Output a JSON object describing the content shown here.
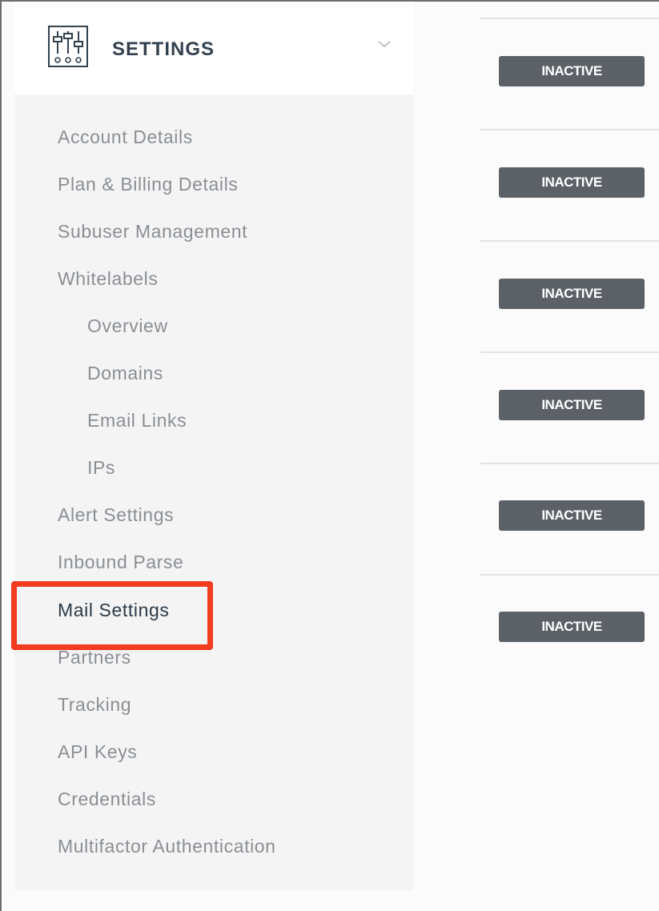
{
  "sidebar": {
    "title": "SETTINGS",
    "items": [
      {
        "label": "Account Details"
      },
      {
        "label": "Plan & Billing Details"
      },
      {
        "label": "Subuser Management"
      },
      {
        "label": "Whitelabels"
      },
      {
        "label": "Overview"
      },
      {
        "label": "Domains"
      },
      {
        "label": "Email Links"
      },
      {
        "label": "IPs"
      },
      {
        "label": "Alert Settings"
      },
      {
        "label": "Inbound Parse"
      },
      {
        "label": "Mail Settings"
      },
      {
        "label": "Partners"
      },
      {
        "label": "Tracking"
      },
      {
        "label": "API Keys"
      },
      {
        "label": "Credentials"
      },
      {
        "label": "Multifactor Authentication"
      }
    ]
  },
  "main": {
    "statuses": [
      {
        "label": "INACTIVE"
      },
      {
        "label": "INACTIVE"
      },
      {
        "label": "INACTIVE"
      },
      {
        "label": "INACTIVE"
      },
      {
        "label": "INACTIVE"
      },
      {
        "label": "INACTIVE"
      }
    ]
  },
  "colors": {
    "highlight": "#f23b1f",
    "badge": "#5c6168",
    "sidebar_bg": "#f4f4f4",
    "nav_text": "#8a8f95",
    "active_text": "#2b3a47"
  },
  "icons": {
    "settings": "sliders-icon",
    "expand": "chevron-down-icon"
  }
}
